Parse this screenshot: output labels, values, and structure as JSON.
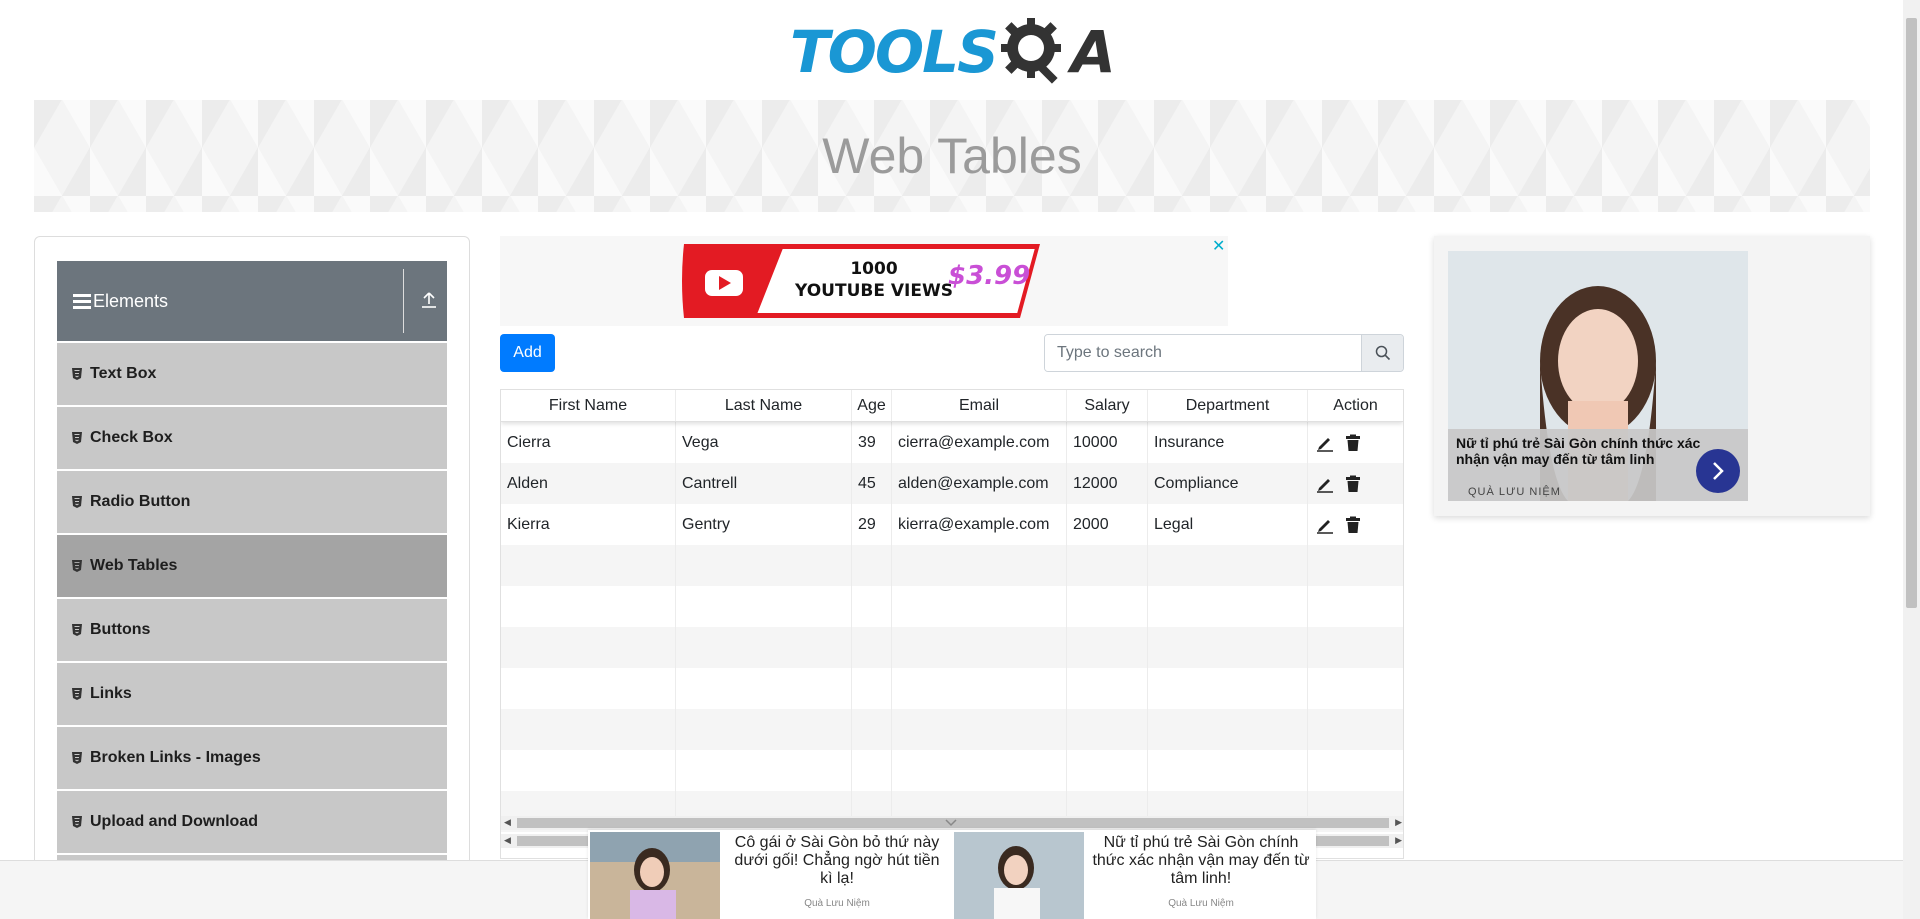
{
  "logo": {
    "text_left": "TOOLS",
    "text_right": "A"
  },
  "banner": {
    "title": "Web Tables"
  },
  "sidebar": {
    "group_title": "Elements",
    "items": [
      {
        "label": "Text Box"
      },
      {
        "label": "Check Box"
      },
      {
        "label": "Radio Button"
      },
      {
        "label": "Web Tables",
        "active": true
      },
      {
        "label": "Buttons"
      },
      {
        "label": "Links"
      },
      {
        "label": "Broken Links - Images"
      },
      {
        "label": "Upload and Download"
      }
    ]
  },
  "center_ad": {
    "line1": "1000",
    "line2": "YOUTUBE VIEWS",
    "price": "$3.99",
    "close": "✕"
  },
  "toolbar": {
    "add_label": "Add",
    "search_placeholder": "Type to search"
  },
  "table": {
    "headers": [
      "First Name",
      "Last Name",
      "Age",
      "Email",
      "Salary",
      "Department",
      "Action"
    ],
    "rows": [
      [
        "Cierra",
        "Vega",
        "39",
        "cierra@example.com",
        "10000",
        "Insurance"
      ],
      [
        "Alden",
        "Cantrell",
        "45",
        "alden@example.com",
        "12000",
        "Compliance"
      ],
      [
        "Kierra",
        "Gentry",
        "29",
        "kierra@example.com",
        "2000",
        "Legal"
      ]
    ]
  },
  "right_ad": {
    "title": "Nữ tỉ phú trẻ Sài Gòn chính thức xác nhận vận may đến từ tâm linh",
    "source": "QUÀ LƯU NIỆM"
  },
  "bottom_ad": {
    "items": [
      {
        "text": "Cô gái ở Sài Gòn bỏ thứ này dưới gối! Chẳng ngờ hút tiền kì lạ!",
        "source": "Quà Lưu Niệm"
      },
      {
        "text": "Nữ tỉ phú trẻ Sài Gòn chính thức xác nhận vận may đến từ tâm linh!",
        "source": "Quà Lưu Niệm"
      }
    ]
  },
  "colors": {
    "primary": "#007bff",
    "logo_blue": "#1a97d4",
    "sidebar_header": "#6c757d",
    "menu_item": "#c8c8c8",
    "menu_active": "#a4a4a4"
  }
}
